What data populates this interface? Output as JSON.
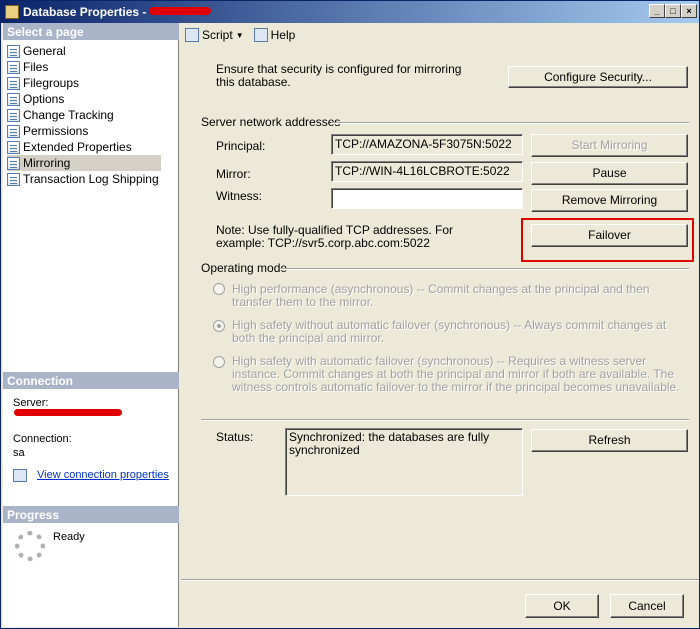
{
  "window": {
    "title": "Database Properties - "
  },
  "left": {
    "select_page": "Select a page",
    "pages": [
      "General",
      "Files",
      "Filegroups",
      "Options",
      "Change Tracking",
      "Permissions",
      "Extended Properties",
      "Mirroring",
      "Transaction Log Shipping"
    ],
    "selected_page": "Mirroring",
    "connection": {
      "header": "Connection",
      "server_label": "Server:",
      "connection_label": "Connection:",
      "connection_value": "sa",
      "view_link": "View connection properties"
    },
    "progress": {
      "header": "Progress",
      "status": "Ready"
    }
  },
  "toolbar": {
    "script": "Script",
    "help": "Help"
  },
  "mirroring": {
    "security_note": "Ensure that security is configured for mirroring this database.",
    "configure_security": "Configure Security...",
    "server_group": "Server network addresses",
    "principal_label": "Principal:",
    "principal_value": "TCP://AMAZONA-5F3075N:5022",
    "mirror_label": "Mirror:",
    "mirror_value": "TCP://WIN-4L16LCBROTE:5022",
    "witness_label": "Witness:",
    "witness_value": "",
    "start_mirroring": "Start Mirroring",
    "pause": "Pause",
    "remove_mirroring": "Remove Mirroring",
    "failover": "Failover",
    "note": "Note: Use fully-qualified TCP addresses. For example: TCP://svr5.corp.abc.com:5022",
    "operating_mode": "Operating mode",
    "modes": [
      "High performance (asynchronous) -- Commit changes at the principal and then transfer them to the mirror.",
      "High safety without automatic failover (synchronous) -- Always commit changes at both the principal and mirror.",
      "High safety with automatic failover (synchronous) -- Requires a witness server instance. Commit changes at both the principal and mirror if both are available. The witness controls automatic failover to the mirror if the principal becomes unavailable."
    ],
    "status_label": "Status:",
    "status_value": "Synchronized: the databases are fully synchronized",
    "refresh": "Refresh"
  },
  "footer": {
    "ok": "OK",
    "cancel": "Cancel"
  },
  "colors": {
    "highlight": "#e00000",
    "title_bar": "#0a246a",
    "section_head": "#a9b4c8"
  }
}
